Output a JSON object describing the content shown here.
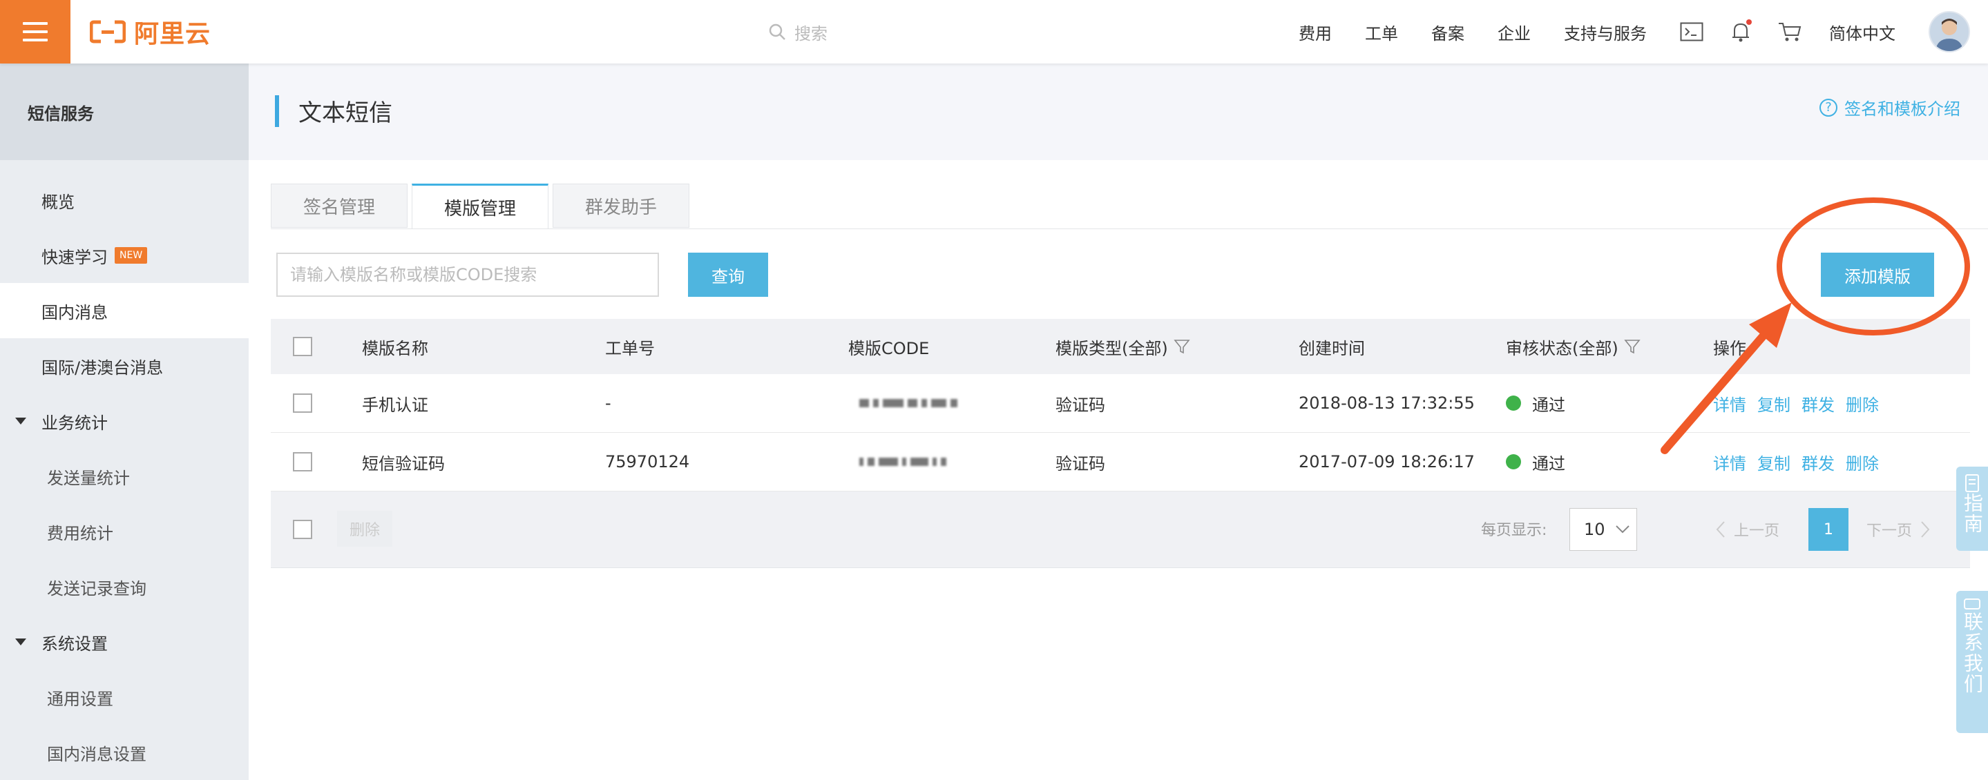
{
  "brand": {
    "logo_text": "阿里云",
    "accent_color": "#f07b2d"
  },
  "topbar": {
    "search_placeholder": "搜索",
    "nav": [
      "费用",
      "工单",
      "备案",
      "企业",
      "支持与服务"
    ],
    "language": "简体中文",
    "icons": [
      "terminal-icon",
      "bell-icon",
      "cart-icon",
      "avatar"
    ]
  },
  "sidebar": {
    "title": "短信服务",
    "items": [
      {
        "label": "概览"
      },
      {
        "label": "快速学习",
        "badge": "NEW"
      },
      {
        "label": "国内消息",
        "active": true
      },
      {
        "label": "国际/港澳台消息"
      }
    ],
    "groups": [
      {
        "label": "业务统计",
        "children": [
          "发送量统计",
          "费用统计",
          "发送记录查询"
        ]
      },
      {
        "label": "系统设置",
        "children": [
          "通用设置",
          "国内消息设置"
        ]
      }
    ]
  },
  "page": {
    "title": "文本短信",
    "help_link": "签名和模板介绍",
    "tabs": [
      "签名管理",
      "模版管理",
      "群发助手"
    ],
    "active_tab": 1,
    "search_placeholder": "请输入模版名称或模版CODE搜索",
    "query_button": "查询",
    "add_button": "添加模版"
  },
  "table": {
    "headers": [
      "模版名称",
      "工单号",
      "模版CODE",
      "模版类型(全部)",
      "创建时间",
      "审核状态(全部)",
      "操作"
    ],
    "rows": [
      {
        "name": "手机认证",
        "ticket": "-",
        "type": "验证码",
        "created": "2018-08-13 17:32:55",
        "status": "通过"
      },
      {
        "name": "短信验证码",
        "ticket": "75970124",
        "type": "验证码",
        "created": "2017-07-09 18:26:17",
        "status": "通过"
      }
    ],
    "actions": [
      "详情",
      "复制",
      "群发",
      "删除"
    ],
    "footer": {
      "delete_button": "删除",
      "per_page_label": "每页显示:",
      "page_size": "10",
      "prev": "上一页",
      "current_page": "1",
      "next": "下一页"
    }
  },
  "float": {
    "guide": "指南",
    "contact": "联系我们"
  },
  "colors": {
    "primary": "#4fb5df",
    "status_ok": "#3fb24a",
    "annotation": "#f05a28"
  }
}
